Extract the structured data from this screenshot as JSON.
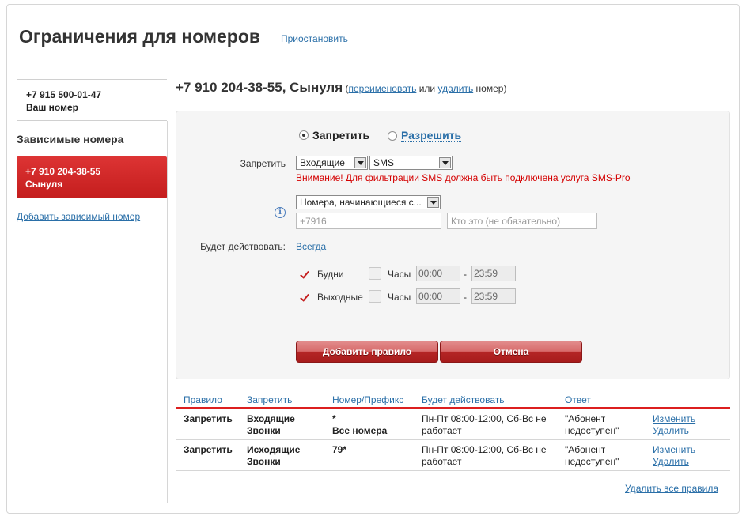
{
  "page": {
    "title": "Ограничения для номеров",
    "suspend_link": "Приостановить"
  },
  "sidebar": {
    "own_number": "+7 915 500-01-47",
    "own_number_caption": "Ваш номер",
    "dependents_heading": "Зависимые номера",
    "dependents": [
      {
        "number": "+7 910 204-38-55",
        "name": "Сынуля",
        "selected": true
      }
    ],
    "add_dependent_link": "Добавить зависимый номер"
  },
  "selected": {
    "title": "+7 910 204-38-55, Сынуля",
    "paren_open": "(",
    "rename_link": "переименовать",
    "or_text": "или",
    "delete_link": "удалить",
    "number_text": "номер)"
  },
  "form": {
    "mode_options": [
      {
        "label": "Запретить",
        "checked": true
      },
      {
        "label": "Разрешить",
        "checked": false
      }
    ],
    "forbid_label": "Запретить",
    "direction_select": "Входящие",
    "type_select": "SMS",
    "warning": "Внимание! Для фильтрации SMS должна быть подключена услуга SMS-Pro",
    "info_icon": "info-icon",
    "number_filter_select": "Номера, начинающиеся с...",
    "number_input_placeholder": "+7916",
    "who_input_placeholder": "Кто это (не обязательно)",
    "active_label": "Будет действовать:",
    "active_link": "Всегда",
    "schedule": [
      {
        "day_label": "Будни",
        "day_checked": true,
        "hours_label": "Часы",
        "hours_checked": false,
        "from": "00:00",
        "dash": "-",
        "to": "23:59"
      },
      {
        "day_label": "Выходные",
        "day_checked": true,
        "hours_label": "Часы",
        "hours_checked": false,
        "from": "00:00",
        "dash": "-",
        "to": "23:59"
      }
    ],
    "add_button": "Добавить правило",
    "cancel_button": "Отмена"
  },
  "rules_table": {
    "columns": [
      "Правило",
      "Запретить",
      "Номер/Префикс",
      "Будет действовать",
      "Ответ"
    ],
    "rows": [
      {
        "rule": "Запретить",
        "forbid": [
          "Входящие",
          "Звонки"
        ],
        "prefix": [
          "*",
          "Все номера"
        ],
        "schedule": [
          "Пн-Пт 08:00-12:00, Сб-Вс не",
          "работает"
        ],
        "answer": [
          "\"Абонент",
          "недоступен\""
        ],
        "edit": "Изменить",
        "delete": "Удалить"
      },
      {
        "rule": "Запретить",
        "forbid": [
          "Исходящие",
          "Звонки"
        ],
        "prefix": [
          "79*",
          ""
        ],
        "schedule": [
          "Пн-Пт 08:00-12:00, Сб-Вс не",
          "работает"
        ],
        "answer": [
          "\"Абонент",
          "недоступен\""
        ],
        "edit": "Изменить",
        "delete": "Удалить"
      }
    ],
    "delete_all_link": "Удалить все правила"
  },
  "colors": {
    "accent_red": "#c41d1d",
    "link_blue": "#2a6fa8",
    "warning_red": "#d40000"
  }
}
